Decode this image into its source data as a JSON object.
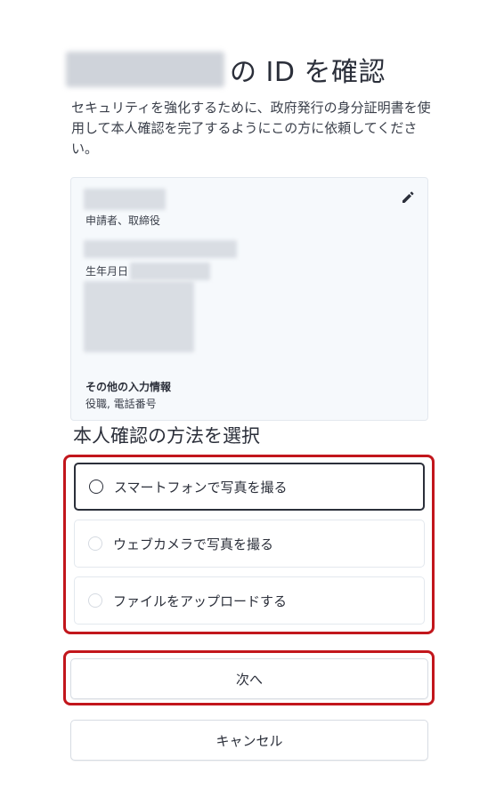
{
  "header": {
    "title_suffix": "の ID を確認",
    "description": "セキュリティを強化するために、政府発行の身分証明書を使用して本人確認を完了するようにこの方に依頼してください。"
  },
  "applicant_card": {
    "role": "申請者、取締役",
    "dob_label": "生年月日",
    "other_info_title": "その他の入力情報",
    "other_info_items": "役職, 電話番号",
    "edit_icon": "pencil-icon"
  },
  "method": {
    "section_title": "本人確認の方法を選択",
    "options": [
      {
        "label": "スマートフォンで写真を撮る",
        "selected": true
      },
      {
        "label": "ウェブカメラで写真を撮る",
        "selected": false
      },
      {
        "label": "ファイルをアップロードする",
        "selected": false
      }
    ]
  },
  "buttons": {
    "next_label": "次へ",
    "cancel_label": "キャンセル"
  },
  "colors": {
    "highlight_red": "#c2161c",
    "text": "#2b2f3a",
    "card_bg": "#f6f9fc"
  }
}
